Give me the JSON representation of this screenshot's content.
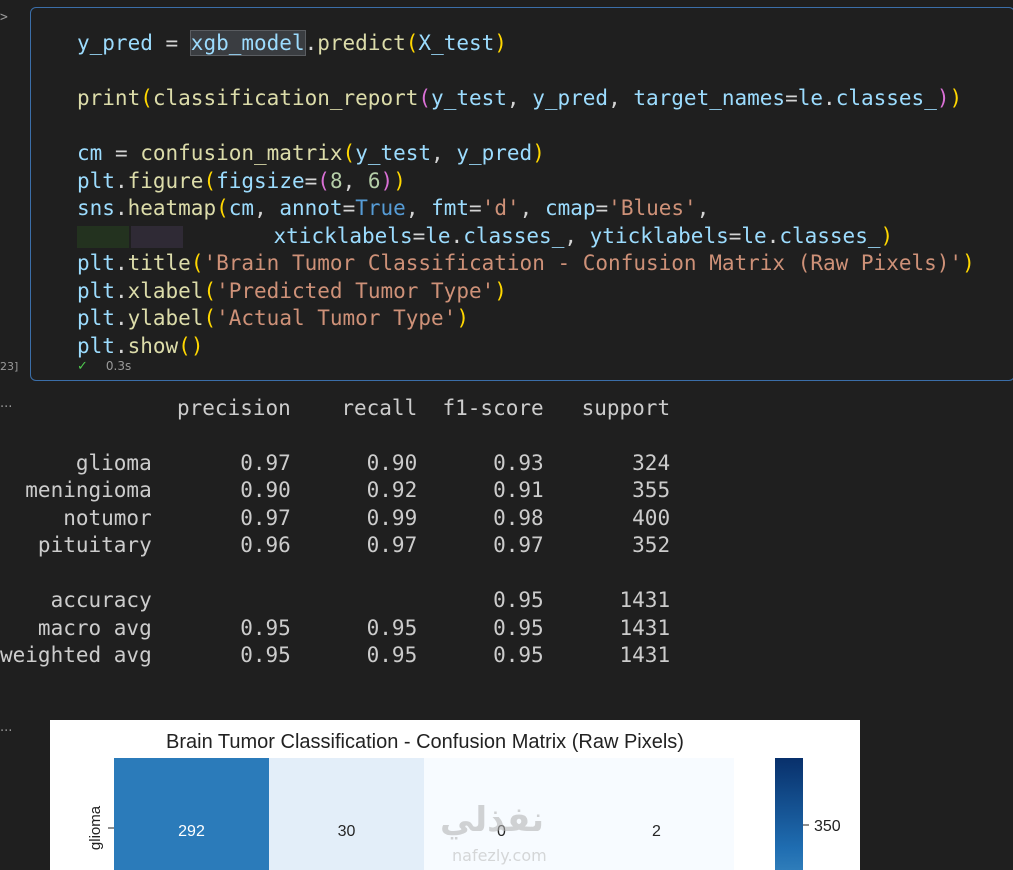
{
  "gutter": {
    "collapse_glyph": ">",
    "exec_count": "23]",
    "output_dots": "..."
  },
  "cell": {
    "lines": [
      "y_pred = xgb_model.predict(X_test)",
      "",
      "print(classification_report(y_test, y_pred, target_names=le.classes_))",
      "",
      "cm = confusion_matrix(y_test, y_pred)",
      "plt.figure(figsize=(8, 6))",
      "sns.heatmap(cm, annot=True, fmt='d', cmap='Blues',",
      "            xticklabels=le.classes_, yticklabels=le.classes_)",
      "plt.title('Brain Tumor Classification - Confusion Matrix (Raw Pixels)')",
      "plt.xlabel('Predicted Tumor Type')",
      "plt.ylabel('Actual Tumor Type')",
      "plt.show()"
    ],
    "status_check": "✓",
    "duration": "0.3s"
  },
  "report": {
    "header": "              precision    recall  f1-score   support",
    "rows": [
      "",
      "      glioma       0.97      0.90      0.93       324",
      "  meningioma       0.90      0.92      0.91       355",
      "     notumor       0.97      0.99      0.98       400",
      "   pituitary       0.96      0.97      0.97       352",
      "",
      "    accuracy                           0.95      1431",
      "   macro avg       0.95      0.95      0.95      1431",
      "weighted avg       0.95      0.95      0.95      1431"
    ]
  },
  "chart_data": {
    "type": "heatmap",
    "title": "Brain Tumor Classification - Confusion Matrix (Raw Pixels)",
    "visible_rows": [
      "glioma"
    ],
    "values": [
      [
        292,
        30,
        0,
        2
      ]
    ],
    "colorbar_ticks": [
      350
    ],
    "cmap": "Blues",
    "cell_colors": [
      "#2b7bba",
      "#e3eef9",
      "#f7fbff",
      "#f7fbff"
    ]
  },
  "watermark": {
    "arabic": "نفذلي",
    "latin": "nafezly.com"
  }
}
